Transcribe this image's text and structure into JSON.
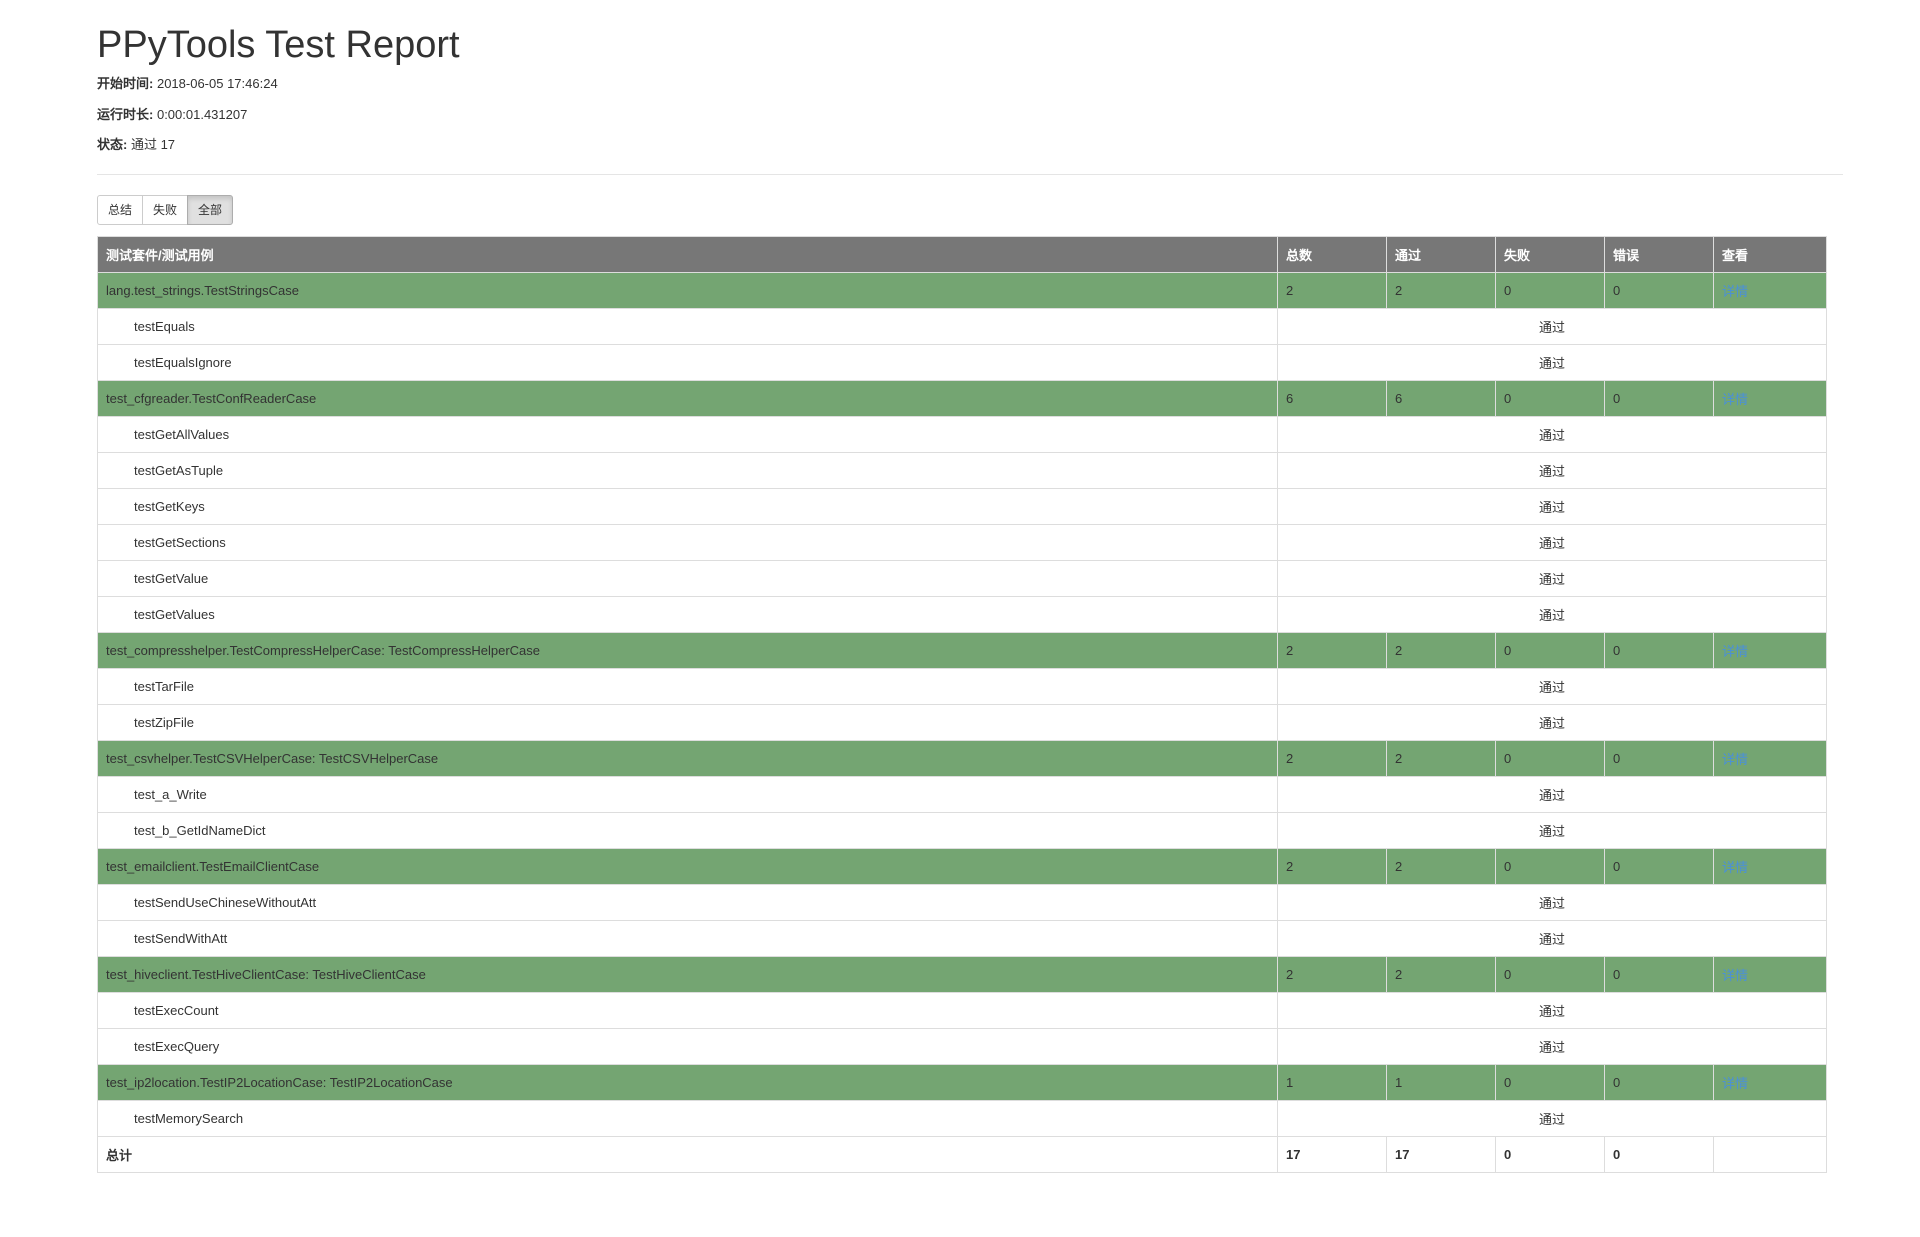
{
  "title": "PPyTools Test Report",
  "meta": {
    "start_label": "开始时间:",
    "start_value": "2018-06-05 17:46:24",
    "duration_label": "运行时长:",
    "duration_value": "0:00:01.431207",
    "status_label": "状态:",
    "status_value": "通过 17"
  },
  "filters": {
    "summary": "总结",
    "failed": "失败",
    "all": "全部",
    "active": "all"
  },
  "table": {
    "headers": [
      "测试套件/测试用例",
      "总数",
      "通过",
      "失败",
      "错误",
      "查看"
    ],
    "suites": [
      {
        "name": "lang.test_strings.TestStringsCase",
        "total": "2",
        "pass": "2",
        "fail": "0",
        "error": "0",
        "view": "详情",
        "cases": [
          {
            "name": "testEquals",
            "status": "通过"
          },
          {
            "name": "testEqualsIgnore",
            "status": "通过"
          }
        ]
      },
      {
        "name": "test_cfgreader.TestConfReaderCase",
        "total": "6",
        "pass": "6",
        "fail": "0",
        "error": "0",
        "view": "详情",
        "cases": [
          {
            "name": "testGetAllValues",
            "status": "通过"
          },
          {
            "name": "testGetAsTuple",
            "status": "通过"
          },
          {
            "name": "testGetKeys",
            "status": "通过"
          },
          {
            "name": "testGetSections",
            "status": "通过"
          },
          {
            "name": "testGetValue",
            "status": "通过"
          },
          {
            "name": "testGetValues",
            "status": "通过"
          }
        ]
      },
      {
        "name": "test_compresshelper.TestCompressHelperCase: TestCompressHelperCase",
        "total": "2",
        "pass": "2",
        "fail": "0",
        "error": "0",
        "view": "详情",
        "cases": [
          {
            "name": "testTarFile",
            "status": "通过"
          },
          {
            "name": "testZipFile",
            "status": "通过"
          }
        ]
      },
      {
        "name": "test_csvhelper.TestCSVHelperCase: TestCSVHelperCase",
        "total": "2",
        "pass": "2",
        "fail": "0",
        "error": "0",
        "view": "详情",
        "cases": [
          {
            "name": "test_a_Write",
            "status": "通过"
          },
          {
            "name": "test_b_GetIdNameDict",
            "status": "通过"
          }
        ]
      },
      {
        "name": "test_emailclient.TestEmailClientCase",
        "total": "2",
        "pass": "2",
        "fail": "0",
        "error": "0",
        "view": "详情",
        "cases": [
          {
            "name": "testSendUseChineseWithoutAtt",
            "status": "通过"
          },
          {
            "name": "testSendWithAtt",
            "status": "通过"
          }
        ]
      },
      {
        "name": "test_hiveclient.TestHiveClientCase: TestHiveClientCase",
        "total": "2",
        "pass": "2",
        "fail": "0",
        "error": "0",
        "view": "详情",
        "cases": [
          {
            "name": "testExecCount",
            "status": "通过"
          },
          {
            "name": "testExecQuery",
            "status": "通过"
          }
        ]
      },
      {
        "name": "test_ip2location.TestIP2LocationCase: TestIP2LocationCase",
        "total": "1",
        "pass": "1",
        "fail": "0",
        "error": "0",
        "view": "详情",
        "cases": [
          {
            "name": "testMemorySearch",
            "status": "通过"
          }
        ]
      }
    ],
    "totals": {
      "label": "总计",
      "total": "17",
      "pass": "17",
      "fail": "0",
      "error": "0"
    }
  },
  "colors": {
    "header_bg": "#777777",
    "suite_row_bg": "#74a572",
    "link": "#4a90d9"
  }
}
